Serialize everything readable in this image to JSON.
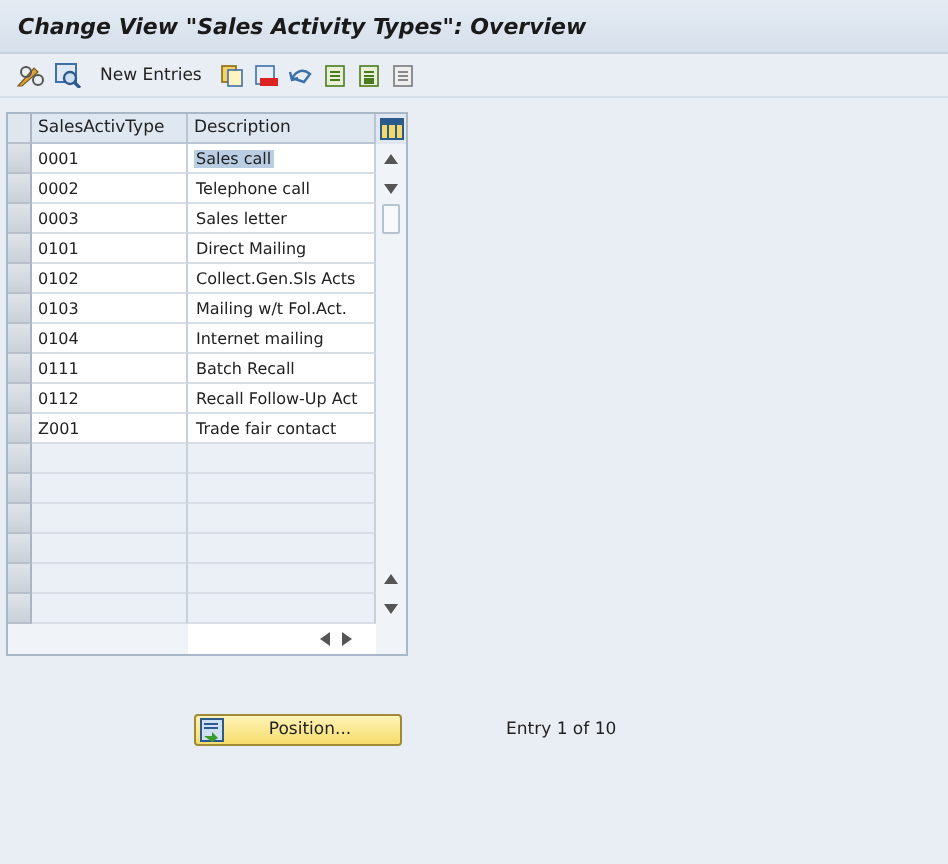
{
  "window": {
    "title": "Change View \"Sales Activity Types\": Overview"
  },
  "toolbar": {
    "new_entries": "New Entries"
  },
  "table": {
    "columns": [
      "SalesActivType",
      "Description"
    ],
    "rows": [
      {
        "type": "0001",
        "description": "Sales call",
        "selected": true
      },
      {
        "type": "0002",
        "description": "Telephone call",
        "selected": false
      },
      {
        "type": "0003",
        "description": "Sales letter",
        "selected": false
      },
      {
        "type": "0101",
        "description": "Direct Mailing",
        "selected": false
      },
      {
        "type": "0102",
        "description": "Collect.Gen.Sls Acts",
        "selected": false
      },
      {
        "type": "0103",
        "description": "Mailing w/t Fol.Act.",
        "selected": false
      },
      {
        "type": "0104",
        "description": "Internet mailing",
        "selected": false
      },
      {
        "type": "0111",
        "description": "Batch Recall",
        "selected": false
      },
      {
        "type": "0112",
        "description": "Recall Follow-Up Act",
        "selected": false
      },
      {
        "type": "Z001",
        "description": "Trade fair contact",
        "selected": false
      }
    ]
  },
  "position_button": "Position...",
  "entry_info": "Entry 1 of 10"
}
